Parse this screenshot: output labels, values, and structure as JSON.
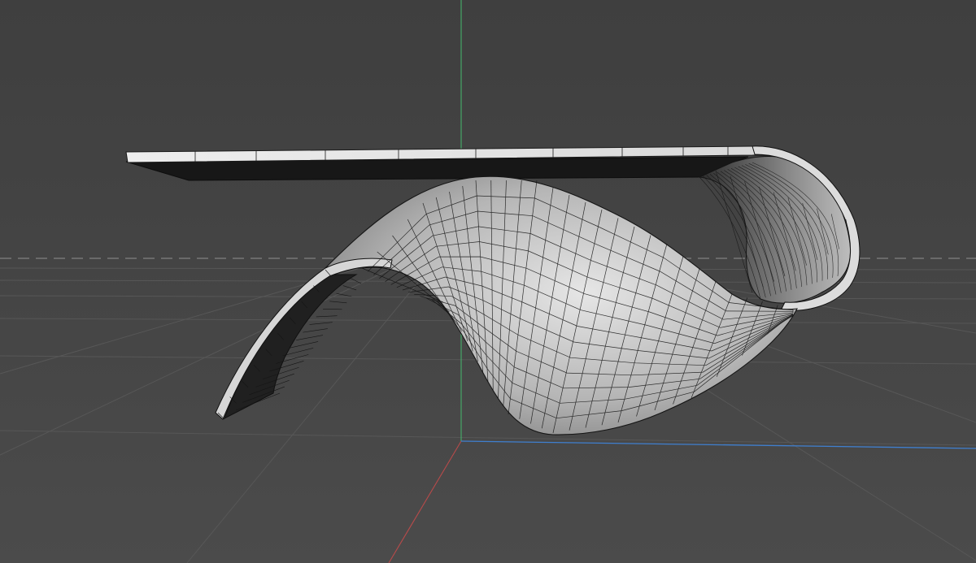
{
  "viewport": {
    "mode": "perspective",
    "shading": "gouraud-with-wireframe",
    "colors": {
      "background_top": "#3f3f3f",
      "background_bottom": "#4a4a4a",
      "grid": "#565656",
      "horizon": "#7a7a7a",
      "axis_x": "#b84a4a",
      "axis_y": "#45b06a",
      "axis_z": "#3f7fcf",
      "mesh_edge": "#111111",
      "mesh_light": "#e4e4e4",
      "mesh_mid": "#9c9c9c",
      "mesh_dark": "#1a1a1a"
    }
  },
  "scene": {
    "objects": [
      {
        "icon": "mesh-icon",
        "shape": "curved-ribbon-table",
        "wireframe": true
      }
    ]
  }
}
